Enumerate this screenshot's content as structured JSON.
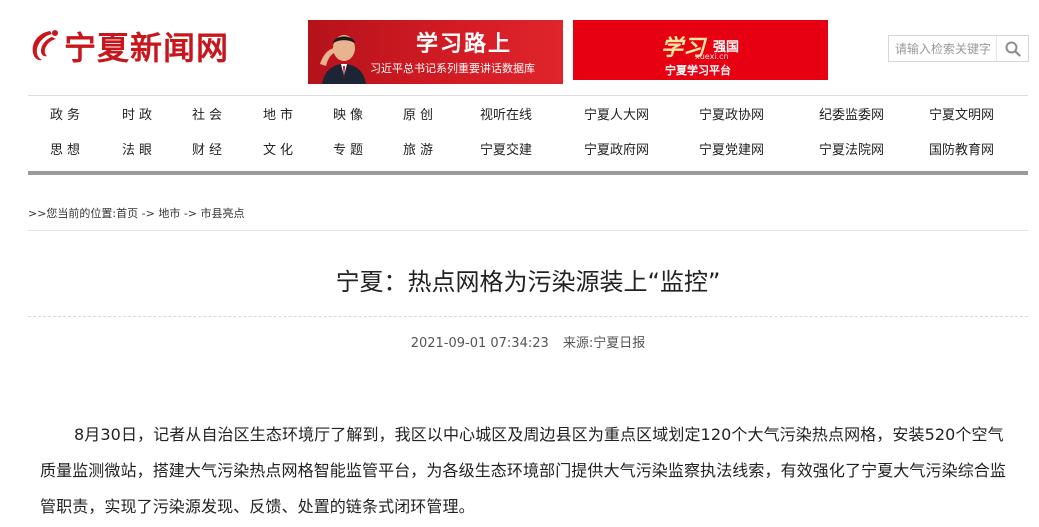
{
  "header": {
    "logo_text": "宁夏新闻网",
    "banner_study": {
      "title": "学习路上",
      "subtitle": "习近平总书记系列重要讲话数据库"
    },
    "banner_xuexi": {
      "brand": "学习",
      "brand_suffix": "强国",
      "url": "xuexi.cn",
      "subtitle": "宁夏学习平台"
    },
    "search": {
      "placeholder": "请输入检索关键字"
    }
  },
  "nav": {
    "row1": [
      "政务",
      "时政",
      "社会",
      "地市",
      "映像",
      "原创",
      "视听在线",
      "宁夏人大网",
      "宁夏政协网",
      "纪委监委网",
      "宁夏文明网"
    ],
    "row2": [
      "思想",
      "法眼",
      "财经",
      "文化",
      "专题",
      "旅游",
      "宁夏交建",
      "宁夏政府网",
      "宁夏党建网",
      "宁夏法院网",
      "国防教育网"
    ]
  },
  "breadcrumb": {
    "prefix": ">>您当前的位置:",
    "items": [
      "首页",
      "地市",
      "市县亮点"
    ],
    "separator": " -> "
  },
  "article": {
    "title": "宁夏：热点网格为污染源装上“监控”",
    "datetime": "2021-09-01 07:34:23",
    "source": "来源:宁夏日报",
    "paragraph": "8月30日，记者从自治区生态环境厅了解到，我区以中心城区及周边县区为重点区域划定120个大气污染热点网格，安装520个空气质量监测微站，搭建大气污染热点网格智能监管平台，为各级生态环境部门提供大气污染监察执法线索，有效强化了宁夏大气污染综合监管职责，实现了污染源发现、反馈、处置的链条式闭环管理。"
  },
  "colors": {
    "brand_red": "#c8161d",
    "nav_bar": "#9a9a9a"
  }
}
